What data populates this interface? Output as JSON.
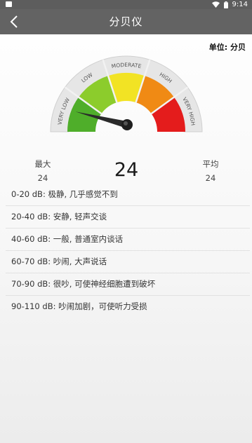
{
  "status_bar": {
    "time": "9:14"
  },
  "app_bar": {
    "title": "分贝仪"
  },
  "unit_label": "单位: 分贝",
  "gauge": {
    "zones": [
      {
        "label": "VERY LOW",
        "color": "#4fae2a"
      },
      {
        "label": "LOW",
        "color": "#8ccc2c"
      },
      {
        "label": "MODERATE",
        "color": "#f2e324"
      },
      {
        "label": "HIGH",
        "color": "#f08a14"
      },
      {
        "label": "VERY HIGH",
        "color": "#e41c1c"
      }
    ],
    "needle_fraction": 0.12
  },
  "stats": {
    "max_label": "最大",
    "max_value": "24",
    "current_value": "24",
    "avg_label": "平均",
    "avg_value": "24"
  },
  "levels": [
    "0-20 dB: 极静, 几乎感觉不到",
    "20-40 dB: 安静, 轻声交谈",
    "40-60 dB: 一般, 普通室内谈话",
    "60-70 dB: 吵闹, 大声说话",
    "70-90 dB: 很吵, 可使神经细胞遭到破坏",
    "90-110 dB: 吵闹加剧，可使听力受损"
  ]
}
